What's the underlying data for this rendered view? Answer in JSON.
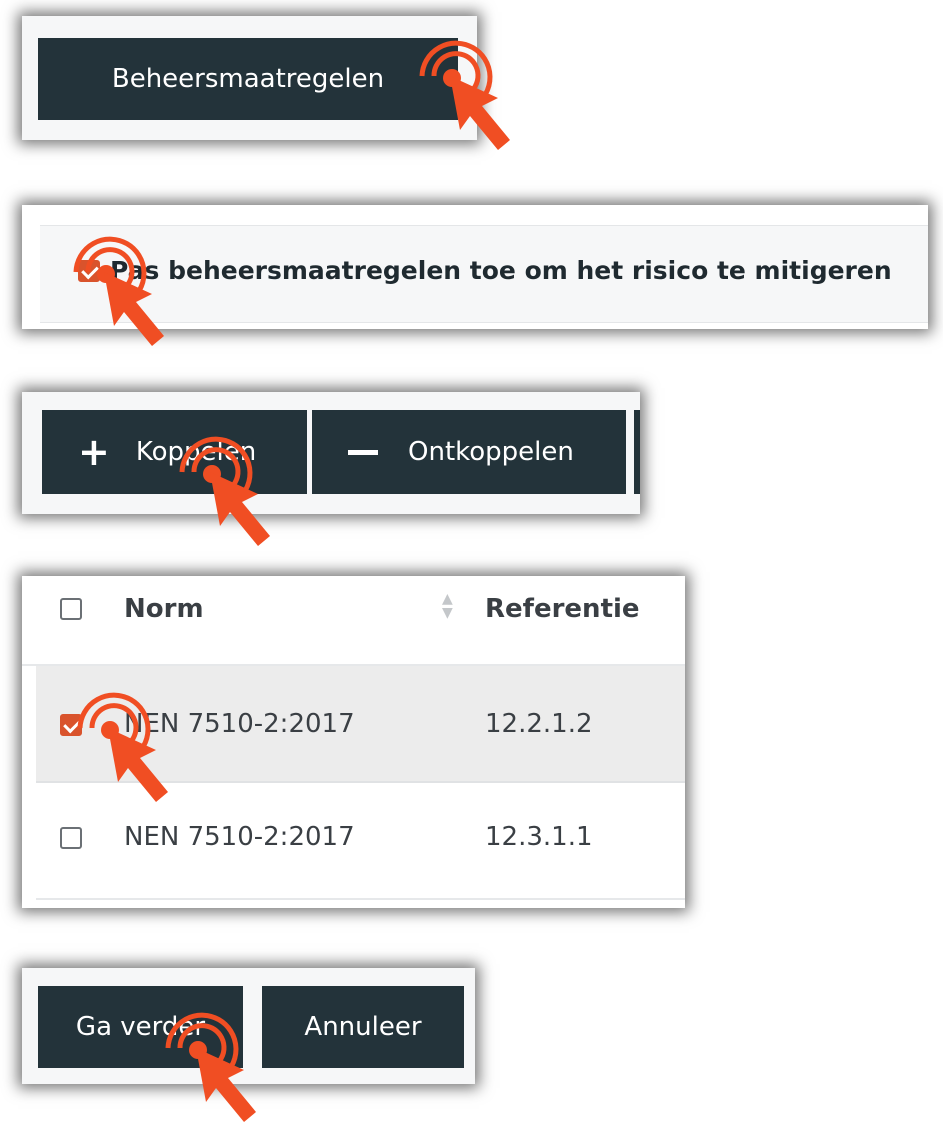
{
  "step1": {
    "button_label": "Beheersmaatregelen"
  },
  "step2": {
    "checkbox_label": "Pas beheersmaatregelen toe om het risico te mitigeren"
  },
  "step3": {
    "link_label": "Koppelen",
    "unlink_label": "Ontkoppelen"
  },
  "step4": {
    "columns": [
      "Norm",
      "Referentie"
    ],
    "rows": [
      {
        "norm": "NEN 7510-2:2017",
        "referentie": "12.2.1.2",
        "checked": true
      },
      {
        "norm": "NEN 7510-2:2017",
        "referentie": "12.3.1.1",
        "checked": false
      }
    ]
  },
  "step5": {
    "continue_label": "Ga verder",
    "cancel_label": "Annuleer"
  },
  "colors": {
    "button_bg": "#23333a",
    "accent": "#f04e23",
    "check": "#d9532c"
  }
}
